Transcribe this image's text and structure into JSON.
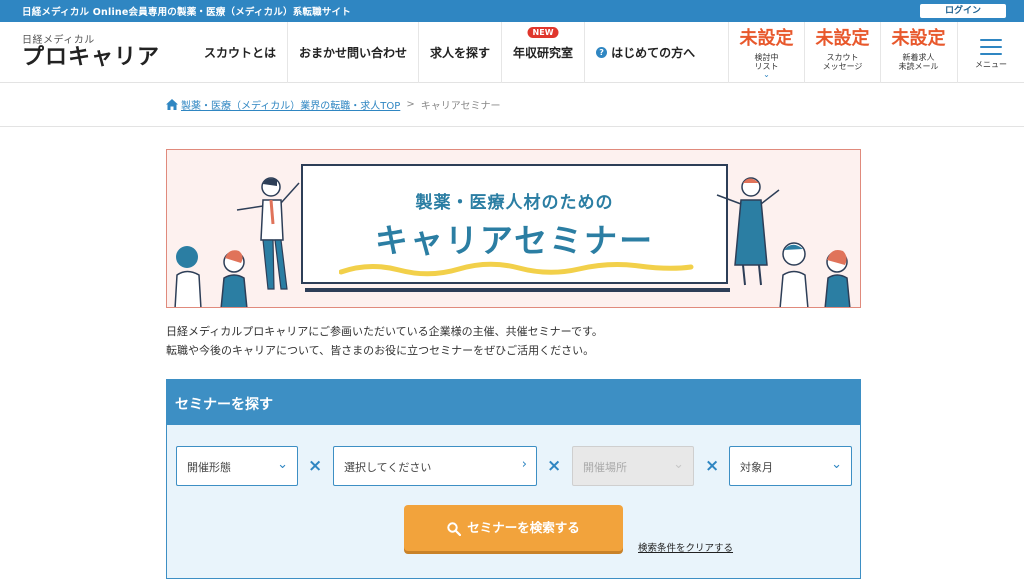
{
  "topbar": {
    "tagline": "日経メディカル Online会員専用の製薬・医療（メディカル）系転職サイト",
    "login_label": "ログイン"
  },
  "logo": {
    "small": "日経メディカル",
    "big": "プロキャリア"
  },
  "nav": {
    "items": [
      {
        "label": "スカウトとは"
      },
      {
        "label": "おまかせ問い合わせ"
      },
      {
        "label": "求人を探す"
      },
      {
        "label": "年収研究室",
        "badge": "NEW"
      },
      {
        "label": "はじめての方へ",
        "icon": "question-circle-icon"
      }
    ]
  },
  "status": [
    {
      "value": "未設定",
      "label": "検討中\nリスト"
    },
    {
      "value": "未設定",
      "label": "スカウト\nメッセージ"
    },
    {
      "value": "未設定",
      "label": "新着求人\n未読メール"
    }
  ],
  "menu": {
    "label": "メニュー"
  },
  "breadcrumb": {
    "home_link": "製薬・医療（メディカル）業界の転職・求人TOP",
    "separator": ">",
    "current": "キャリアセミナー"
  },
  "banner": {
    "line1": "製薬・医療人材のための",
    "line2": "キャリアセミナー"
  },
  "intro": {
    "line1": "日経メディカルプロキャリアにご参画いただいている企業様の主催、共催セミナーです。",
    "line2": "転職や今後のキャリアについて、皆さまのお役に立つセミナーをぜひご活用ください。"
  },
  "search": {
    "title": "セミナーを探す",
    "fields": {
      "format": "開催形態",
      "category": "選択してください",
      "location": "開催場所",
      "month": "対象月"
    },
    "times": "×",
    "button_label": "セミナーを検索する",
    "clear_label": "検索条件をクリアする"
  },
  "colors": {
    "brand_blue": "#2f86c2",
    "status_orange": "#e8582c",
    "button_orange": "#f2a33c",
    "new_badge": "#e0362c"
  }
}
